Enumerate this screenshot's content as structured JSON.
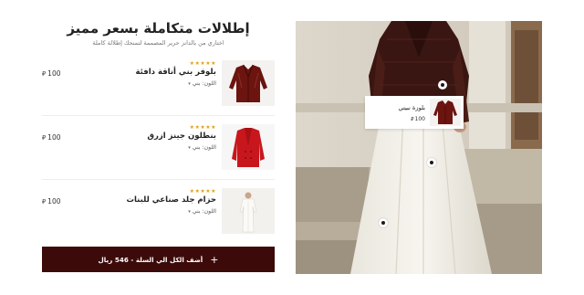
{
  "section": {
    "title": "إطلالات متكاملة بسعر مميز",
    "subtitle": "اختاري من بالدانز حرير المصممة لتمنحك إطلالة كاملة"
  },
  "products": [
    {
      "rating_stars": "★★★★★",
      "name": "بلوفر بني أناقة دافئة",
      "color_label": "اللون: بني",
      "price": "100",
      "currency_icon": "riyal-icon"
    },
    {
      "rating_stars": "★★★★★",
      "name": "بنطلون جينز ازرق",
      "color_label": "اللون: بني",
      "price": "100",
      "currency_icon": "riyal-icon"
    },
    {
      "rating_stars": "★★★★★",
      "name": "حزام جلد صناعي للبنات",
      "color_label": "اللون: بني",
      "price": "100",
      "currency_icon": "riyal-icon"
    }
  ],
  "cta": {
    "label": "أضف الكل الي السلة - 546 ريال",
    "icon": "plus-icon"
  },
  "lookbook": {
    "popup": {
      "name": "بلوزة نبيتي",
      "price": "100"
    },
    "hotspot_count": 3
  },
  "colors": {
    "accent": "#3d0a0a",
    "star": "#e0a316",
    "background": "#ffffff"
  }
}
